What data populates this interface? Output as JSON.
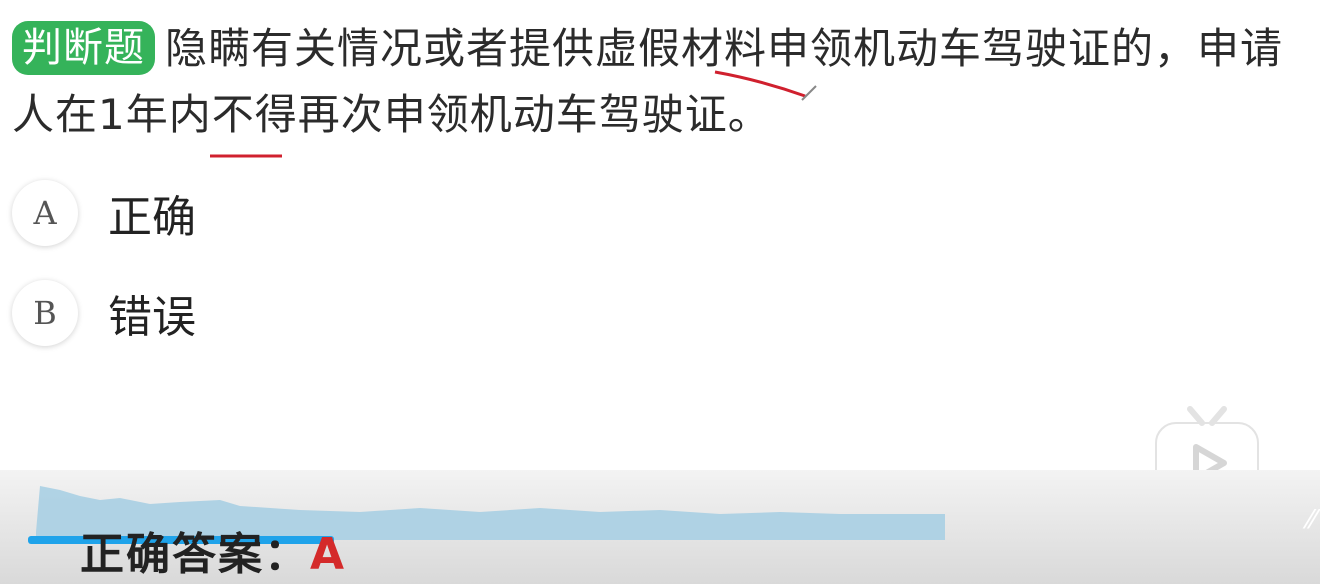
{
  "question": {
    "type_tag": "判断题",
    "text": "隐瞒有关情况或者提供虚假材料申领机动车驾驶证的，申请人在1年内不得再次申领机动车驾驶证。"
  },
  "options": [
    {
      "letter": "A",
      "text": "正确"
    },
    {
      "letter": "B",
      "text": "错误"
    }
  ],
  "answer": {
    "label": "正确答案：",
    "value": "A"
  },
  "player": {
    "progress": 0.23,
    "play_icon": "play-icon"
  },
  "colors": {
    "tag_green": "#35b35a",
    "answer_red": "#d42a2a",
    "progress_blue": "#1fa3ea",
    "annotation_red": "#d0202e"
  }
}
